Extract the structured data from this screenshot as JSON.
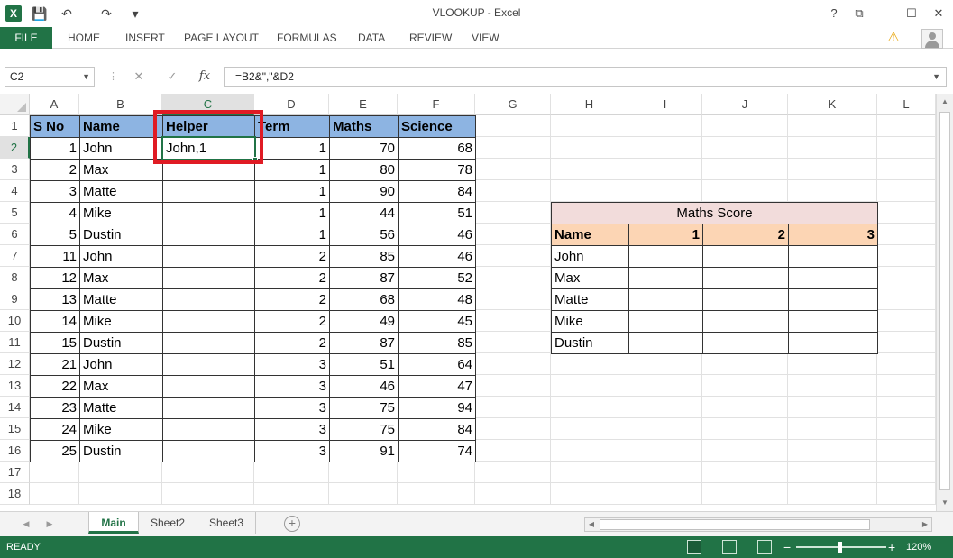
{
  "window": {
    "title": "VLOOKUP - Excel",
    "logo_text": "X",
    "help_label": "?",
    "quick_access": {
      "save": "💾",
      "undo": "↶",
      "redo": "↷",
      "customize": "▾"
    },
    "controls": {
      "restore_ribbon": "⧉",
      "minimize": "—",
      "maximize": "☐",
      "close": "✕"
    }
  },
  "ribbon": {
    "file_label": "FILE",
    "tabs": [
      "HOME",
      "INSERT",
      "PAGE LAYOUT",
      "FORMULAS",
      "DATA",
      "REVIEW",
      "VIEW"
    ]
  },
  "formula_bar": {
    "name_box": "C2",
    "cancel": "✕",
    "enter": "✓",
    "fx": "fx",
    "formula": "=B2&\",\"&D2"
  },
  "columns": [
    "A",
    "B",
    "C",
    "D",
    "E",
    "F",
    "G",
    "H",
    "I",
    "J",
    "K",
    "L"
  ],
  "rows": [
    "1",
    "2",
    "3",
    "4",
    "5",
    "6",
    "7",
    "8",
    "9",
    "10",
    "11",
    "12",
    "13",
    "14",
    "15",
    "16",
    "17",
    "18"
  ],
  "table": {
    "headers": [
      "S No",
      "Name",
      "Helper",
      "Term",
      "Maths",
      "Science"
    ],
    "rows": [
      [
        "1",
        "John",
        "John,1",
        "1",
        "70",
        "68"
      ],
      [
        "2",
        "Max",
        "",
        "1",
        "80",
        "78"
      ],
      [
        "3",
        "Matte",
        "",
        "1",
        "90",
        "84"
      ],
      [
        "4",
        "Mike",
        "",
        "1",
        "44",
        "51"
      ],
      [
        "5",
        "Dustin",
        "",
        "1",
        "56",
        "46"
      ],
      [
        "11",
        "John",
        "",
        "2",
        "85",
        "46"
      ],
      [
        "12",
        "Max",
        "",
        "2",
        "87",
        "52"
      ],
      [
        "13",
        "Matte",
        "",
        "2",
        "68",
        "48"
      ],
      [
        "14",
        "Mike",
        "",
        "2",
        "49",
        "45"
      ],
      [
        "15",
        "Dustin",
        "",
        "2",
        "87",
        "85"
      ],
      [
        "21",
        "John",
        "",
        "3",
        "51",
        "64"
      ],
      [
        "22",
        "Max",
        "",
        "3",
        "46",
        "47"
      ],
      [
        "23",
        "Matte",
        "",
        "3",
        "75",
        "94"
      ],
      [
        "24",
        "Mike",
        "",
        "3",
        "75",
        "84"
      ],
      [
        "25",
        "Dustin",
        "",
        "3",
        "91",
        "74"
      ]
    ]
  },
  "maths_score": {
    "title": "Maths Score",
    "headers": [
      "Name",
      "1",
      "2",
      "3"
    ],
    "names": [
      "John",
      "Max",
      "Matte",
      "Mike",
      "Dustin"
    ]
  },
  "sheets": {
    "tabs": [
      "Main",
      "Sheet2",
      "Sheet3"
    ],
    "active": "Main",
    "add": "+"
  },
  "status": {
    "mode": "READY",
    "zoom": "120%",
    "zoom_minus": "−",
    "zoom_plus": "+"
  },
  "colors": {
    "excel_green": "#217346",
    "header_blue": "#8db4e2",
    "title_pink": "#f2dcdb",
    "header_peach": "#fcd5b4",
    "highlight_red": "#e01b24"
  }
}
